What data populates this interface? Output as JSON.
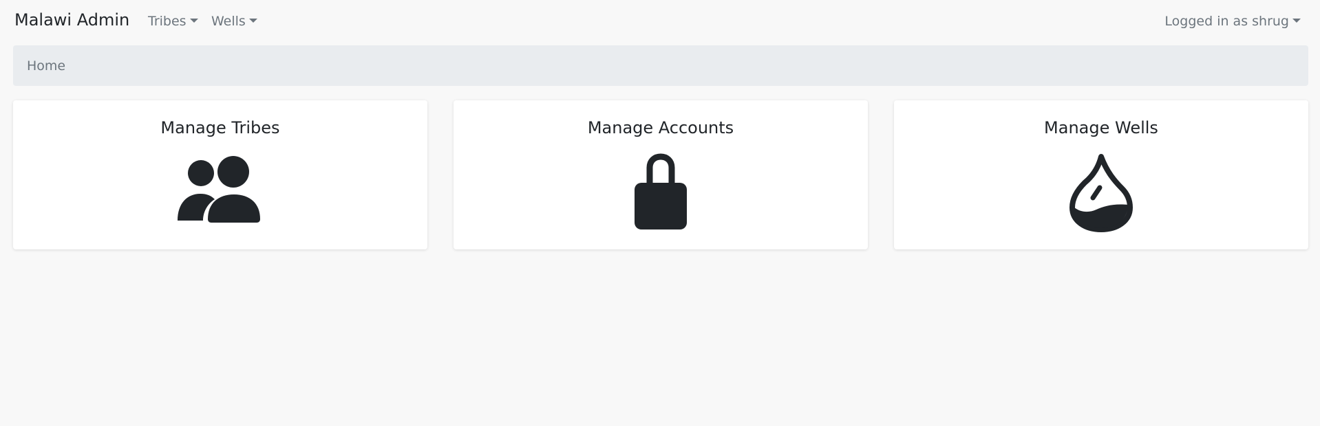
{
  "navbar": {
    "brand": "Malawi Admin",
    "tribes_menu": "Tribes",
    "wells_menu": "Wells",
    "user_menu": "Logged in as shrug"
  },
  "breadcrumb": {
    "items": [
      "Home"
    ]
  },
  "cards": [
    {
      "title": "Manage Tribes",
      "icon": "users-icon"
    },
    {
      "title": "Manage Accounts",
      "icon": "lock-icon"
    },
    {
      "title": "Manage Wells",
      "icon": "water-drop-icon"
    }
  ],
  "colors": {
    "background": "#f8f8f8",
    "breadcrumb_bg": "#e9ecef",
    "card_bg": "#ffffff",
    "icon": "#212529",
    "muted_text": "#6c757d"
  }
}
